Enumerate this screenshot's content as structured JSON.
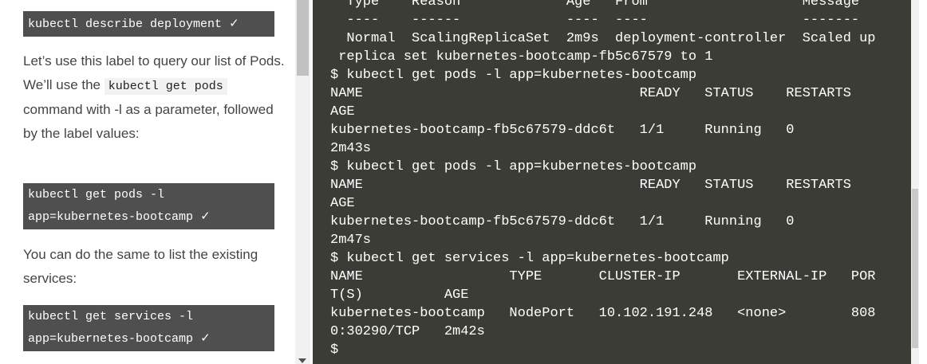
{
  "tutorial": {
    "cmd_describe": "kubectl describe deployment",
    "check_symbol": "✓",
    "para1_before": "Let’s use this label to query our list of Pods. We’ll use the ",
    "para1_code": "kubectl get pods",
    "para1_after": " command with -l as a parameter, followed by the label values:",
    "cmd_get_pods_line1": "kubectl get pods -l",
    "cmd_get_pods_line2": "app=kubernetes-bootcamp",
    "para2": "You can do the same to list the existing services:",
    "cmd_get_services_line1": "kubectl get services -l",
    "cmd_get_services_line2": "app=kubernetes-bootcamp"
  },
  "terminal": {
    "output": "  Type    Reason             Age   From                   Message\n  ----    ------             ----  ----                   -------\n  Normal  ScalingReplicaSet  2m9s  deployment-controller  Scaled up\n replica set kubernetes-bootcamp-fb5c67579 to 1\n$ kubectl get pods -l app=kubernetes-bootcamp\nNAME                                  READY   STATUS    RESTARTS\nAGE\nkubernetes-bootcamp-fb5c67579-ddc6t   1/1     Running   0\n2m43s\n$ kubectl get pods -l app=kubernetes-bootcamp\nNAME                                  READY   STATUS    RESTARTS\nAGE\nkubernetes-bootcamp-fb5c67579-ddc6t   1/1     Running   0\n2m47s\n$ kubectl get services -l app=kubernetes-bootcamp\nNAME                  TYPE       CLUSTER-IP       EXTERNAL-IP   POR\nT(S)          AGE\nkubernetes-bootcamp   NodePort   10.102.191.248   <none>        808\n0:30290/TCP   2m42s\n$"
  },
  "colors": {
    "code_block_bg": "#4f4f4f",
    "terminal_bg": "#3c3c36",
    "prose_text": "#444444"
  }
}
